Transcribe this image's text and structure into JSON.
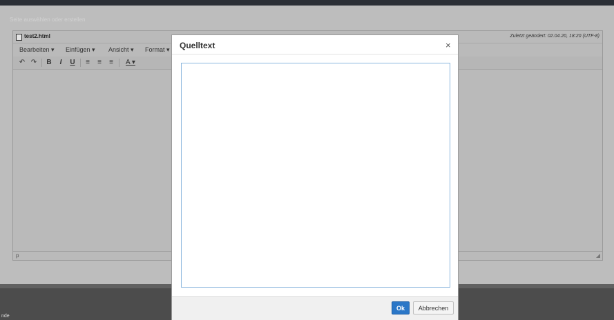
{
  "page": {
    "ghost_text": "Seite auswählen oder erstellen",
    "edge_glyph": "(",
    "footer_text": "nde"
  },
  "editor": {
    "file_name": "test2.html",
    "file_meta": "Zuletzt geändert: 02.04.20, 18:20   (UTF-8)",
    "menus": [
      "Bearbeiten ▾",
      "Einfügen ▾",
      "Ansicht ▾",
      "Format ▾"
    ],
    "toolbar": {
      "undo": "↶",
      "redo": "↷",
      "bold": "B",
      "italic": "I",
      "underline": "U",
      "align_left": "≡",
      "align_center": "≡",
      "align_right": "≡",
      "text_color": "A ▾"
    },
    "path": "p",
    "resize": "◢"
  },
  "dialog": {
    "title": "Quelltext",
    "close": "×",
    "source_value": "",
    "ok_label": "Ok",
    "cancel_label": "Abbrechen"
  },
  "colors": {
    "accent": "#2b77c7",
    "overlay": "#bdbdbd",
    "dialog_bg": "#ffffff"
  }
}
